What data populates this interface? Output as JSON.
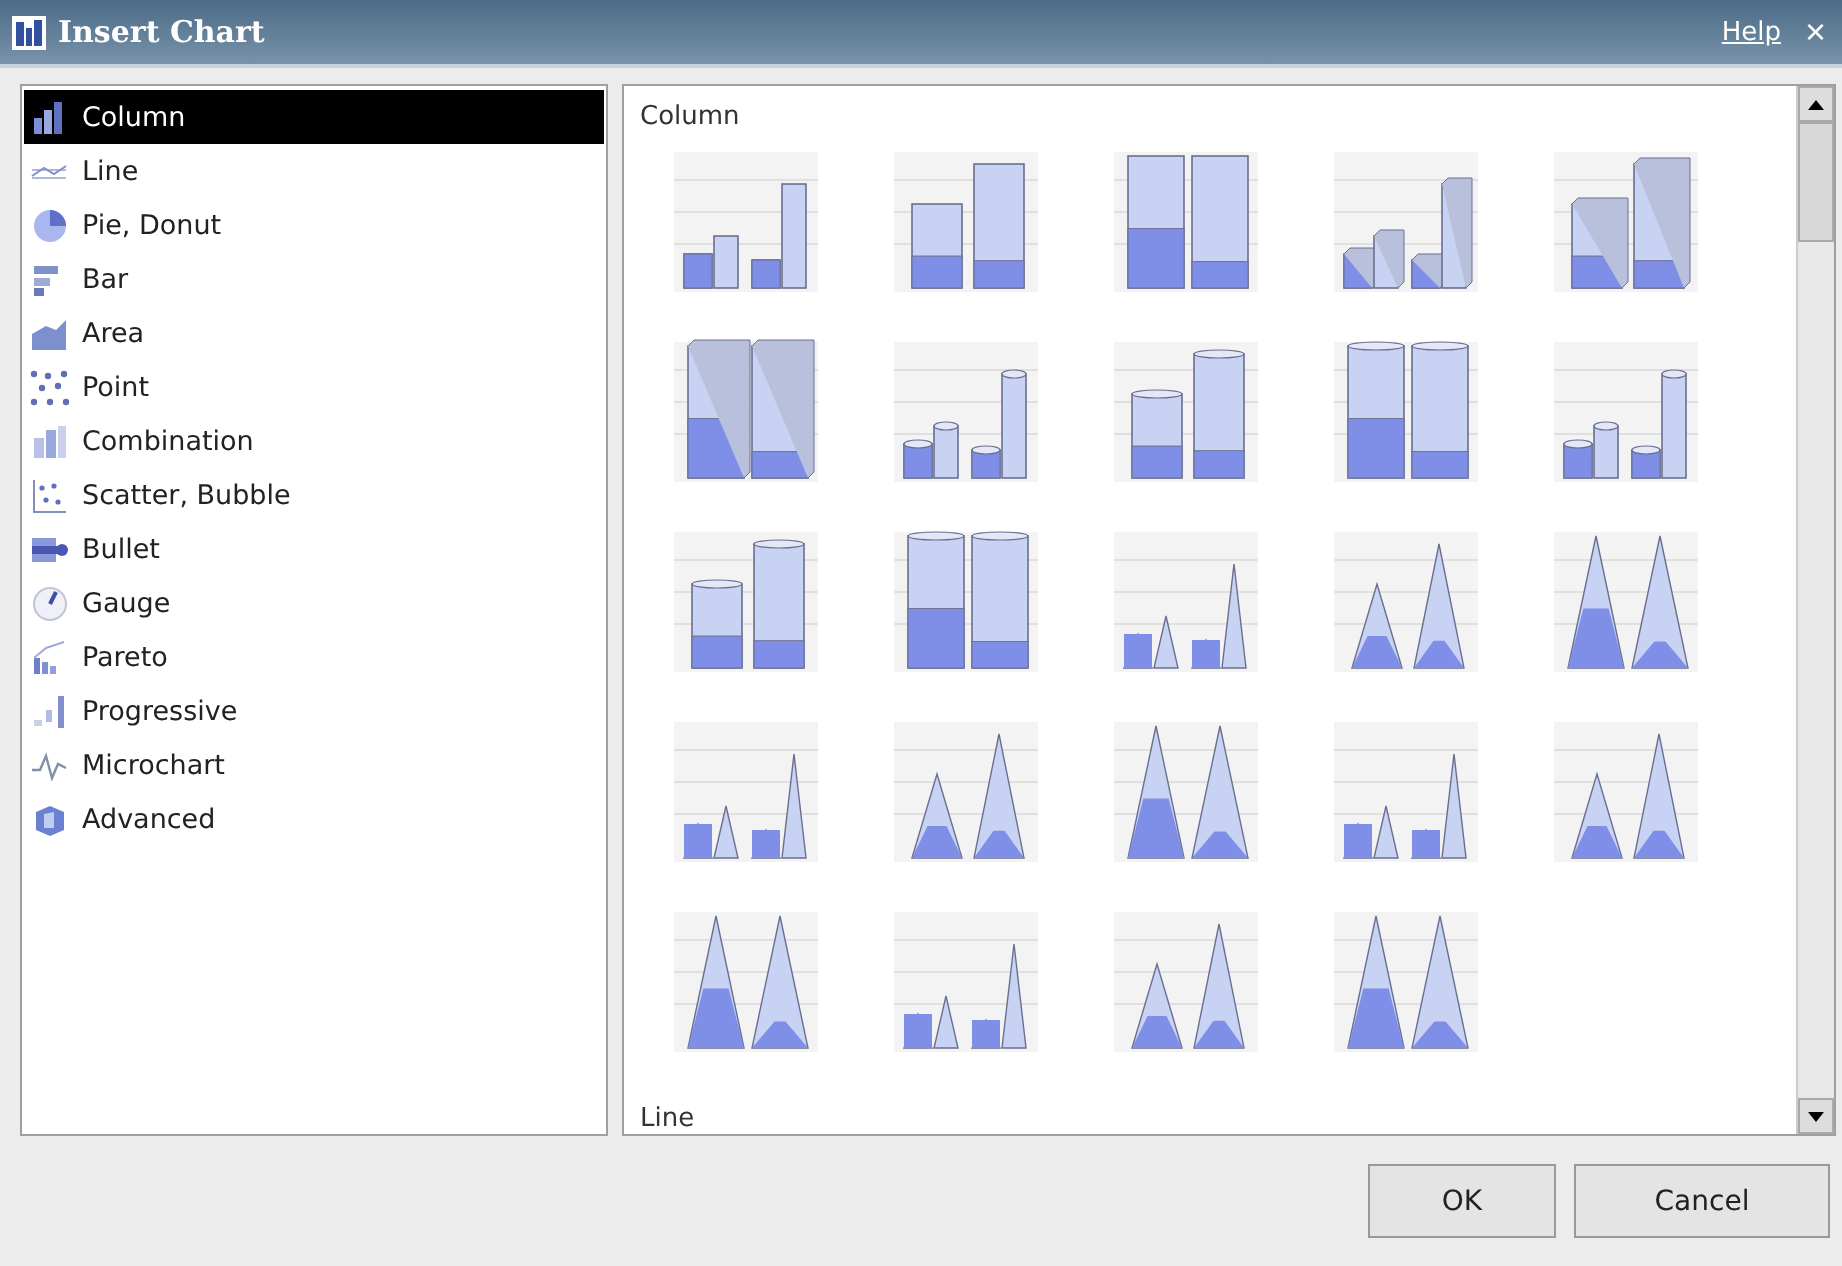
{
  "window": {
    "title": "Insert Chart",
    "help_link": "Help",
    "close": "×"
  },
  "categories": [
    {
      "label": "Column",
      "selected": true
    },
    {
      "label": "Line",
      "selected": false
    },
    {
      "label": "Pie, Donut",
      "selected": false
    },
    {
      "label": "Bar",
      "selected": false
    },
    {
      "label": "Area",
      "selected": false
    },
    {
      "label": "Point",
      "selected": false
    },
    {
      "label": "Combination",
      "selected": false
    },
    {
      "label": "Scatter, Bubble",
      "selected": false
    },
    {
      "label": "Bullet",
      "selected": false
    },
    {
      "label": "Gauge",
      "selected": false
    },
    {
      "label": "Pareto",
      "selected": false
    },
    {
      "label": "Progressive",
      "selected": false
    },
    {
      "label": "Microchart",
      "selected": false
    },
    {
      "label": "Advanced",
      "selected": false
    }
  ],
  "gallery": {
    "section_title": "Column",
    "next_section_title": "Line",
    "thumbnails": [
      {
        "kind": "bar"
      },
      {
        "kind": "bar"
      },
      {
        "kind": "bar"
      },
      {
        "kind": "bar3d"
      },
      {
        "kind": "bar3d"
      },
      {
        "kind": "bar3d"
      },
      {
        "kind": "cylinder"
      },
      {
        "kind": "cylinder"
      },
      {
        "kind": "cylinder"
      },
      {
        "kind": "cylinder"
      },
      {
        "kind": "cylinder"
      },
      {
        "kind": "cylinder"
      },
      {
        "kind": "pyramid"
      },
      {
        "kind": "pyramid"
      },
      {
        "kind": "pyramid"
      },
      {
        "kind": "pyramid"
      },
      {
        "kind": "pyramid"
      },
      {
        "kind": "pyramid"
      },
      {
        "kind": "cone"
      },
      {
        "kind": "cone"
      },
      {
        "kind": "cone"
      },
      {
        "kind": "cone"
      },
      {
        "kind": "cone"
      },
      {
        "kind": "cone"
      }
    ]
  },
  "buttons": [
    "OK",
    "Cancel"
  ]
}
